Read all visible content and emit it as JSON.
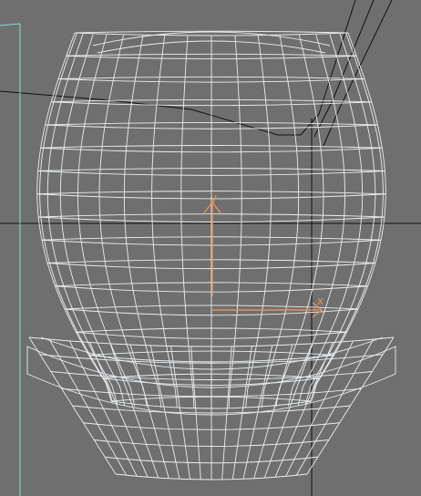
{
  "viewport": {
    "background": "#6f6f6f",
    "wire_color": "#f4f8fb",
    "scene_line_color": "#101010",
    "selection_color": "#7fe0d6",
    "gizmo_color": "#e8915a",
    "wire_opacity": 0.92
  },
  "gizmo": {
    "axis_y_label": "y",
    "axis_x_label": "x"
  }
}
